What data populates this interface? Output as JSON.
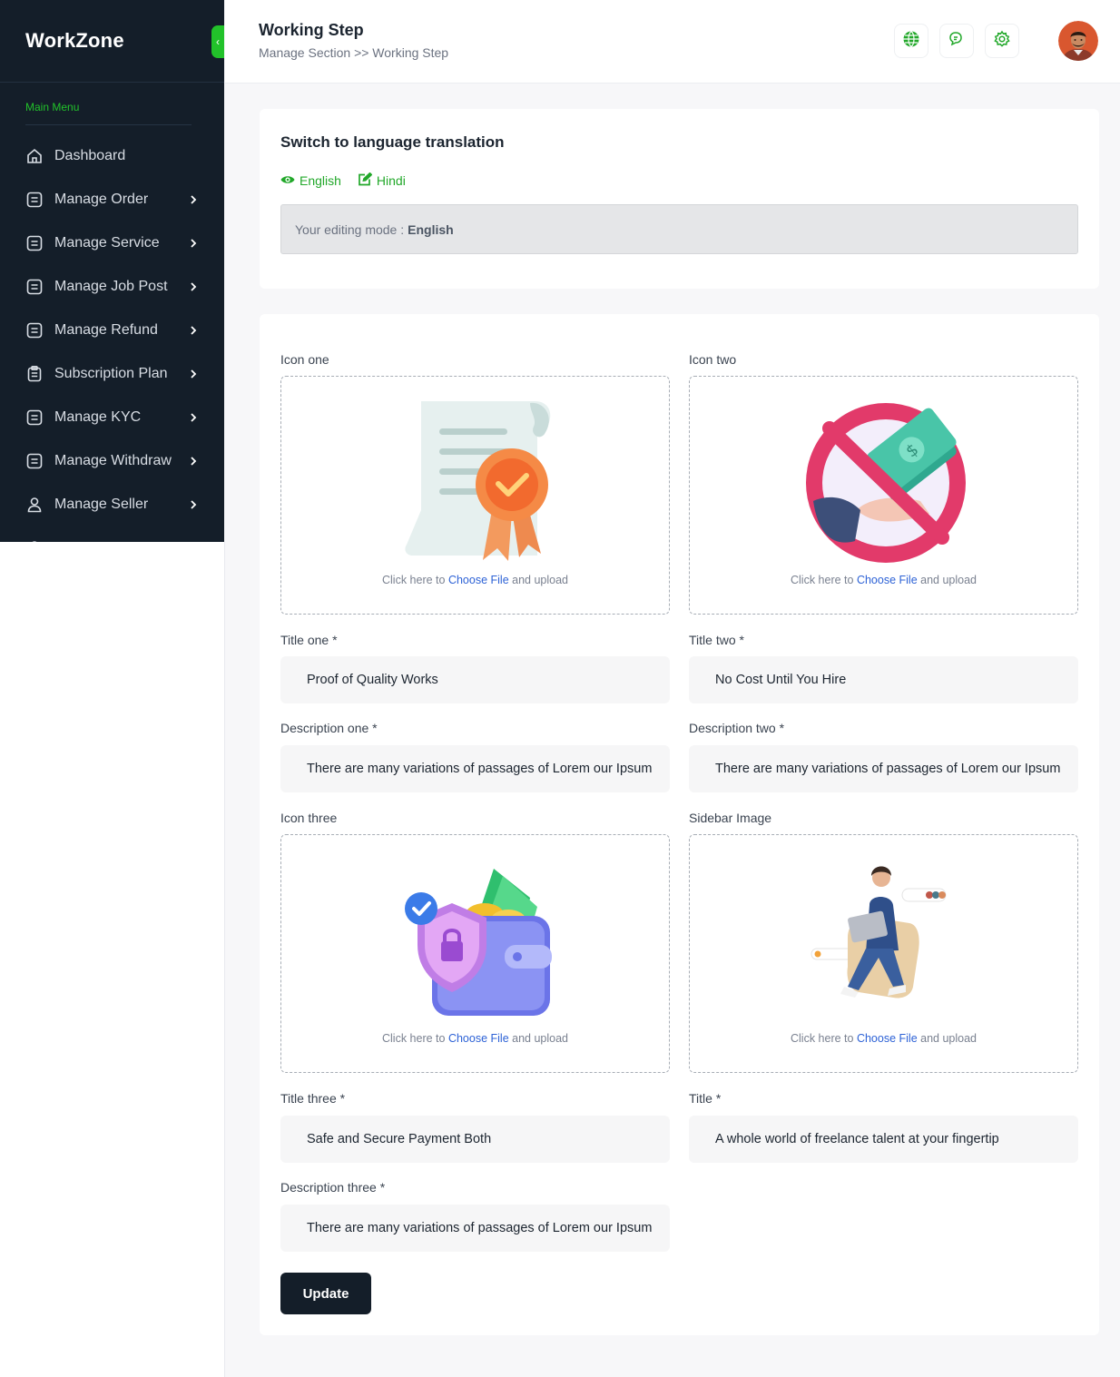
{
  "app": {
    "brand": "WorkZone"
  },
  "sidebar": {
    "caption": "Main Menu",
    "items": [
      {
        "label": "Dashboard",
        "icon": "home-icon",
        "has_children": false
      },
      {
        "label": "Manage Order",
        "icon": "list-icon",
        "has_children": true
      },
      {
        "label": "Manage Service",
        "icon": "list-icon",
        "has_children": true
      },
      {
        "label": "Manage Job Post",
        "icon": "list-icon",
        "has_children": true
      },
      {
        "label": "Manage Refund",
        "icon": "list-icon",
        "has_children": true
      },
      {
        "label": "Subscription Plan",
        "icon": "clipboard-icon",
        "has_children": true
      },
      {
        "label": "Manage KYC",
        "icon": "list-icon",
        "has_children": true
      },
      {
        "label": "Manage Withdraw",
        "icon": "list-icon",
        "has_children": true
      },
      {
        "label": "Manage Seller",
        "icon": "user-icon",
        "has_children": true
      }
    ]
  },
  "header": {
    "title": "Working Step",
    "breadcrumb": "Manage Section >> Working Step"
  },
  "language": {
    "title": "Switch to language translation",
    "tabs": [
      "English",
      "Hindi"
    ],
    "mode_prefix": "Your editing mode :",
    "mode_value": "English"
  },
  "form": {
    "upload_prefix": "Click here to",
    "upload_link": "Choose File",
    "upload_suffix": "and upload",
    "icon_one_label": "Icon one",
    "icon_two_label": "Icon two",
    "title_one_label": "Title one *",
    "title_one_value": "Proof of Quality Works",
    "title_two_label": "Title two *",
    "title_two_value": "No Cost Until You Hire",
    "desc_one_label": "Description one *",
    "desc_one_value": "There are many variations of passages of Lorem our Ipsum",
    "desc_two_label": "Description two *",
    "desc_two_value": "There are many variations of passages of Lorem our Ipsum",
    "icon_three_label": "Icon three",
    "sidebar_image_label": "Sidebar Image",
    "title_three_label": "Title three *",
    "title_three_value": "Safe and Secure Payment Both",
    "title_label": "Title *",
    "title_value": "A whole world of freelance talent at your fingertip",
    "desc_three_label": "Description three *",
    "desc_three_value": "There are many variations of passages of Lorem our Ipsum",
    "update_label": "Update"
  },
  "colors": {
    "accent": "#22c22a",
    "sidebar": "#141e29",
    "link": "#2d62d6"
  }
}
